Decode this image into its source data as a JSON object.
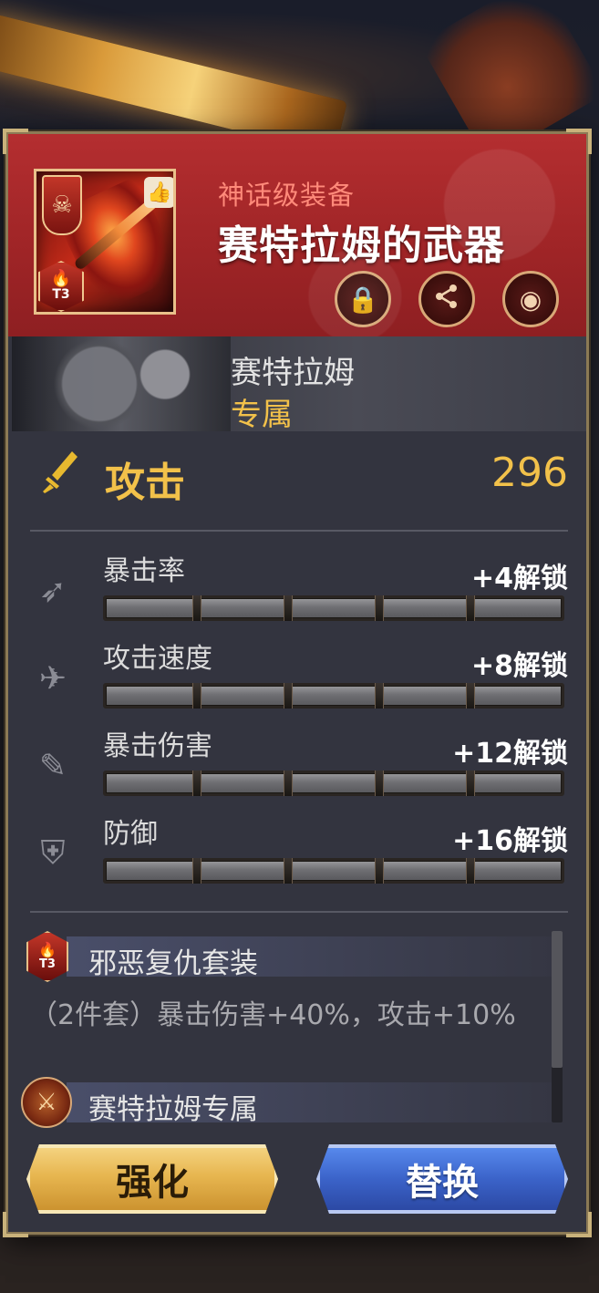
{
  "item": {
    "rarity": "神话级装备",
    "name": "赛特拉姆的武器",
    "tier": "T3",
    "header_buttons": [
      {
        "name": "lock-button",
        "icon": "lock-icon",
        "glyph": "🔒"
      },
      {
        "name": "share-button",
        "icon": "share-icon",
        "glyph": "⮚"
      },
      {
        "name": "sell-button",
        "icon": "coins-icon",
        "glyph": "◉"
      }
    ]
  },
  "hero": {
    "name": "赛特拉姆",
    "tag": "专属"
  },
  "main_stat": {
    "label": "攻击",
    "value": "296",
    "icon": "sword-icon"
  },
  "sub_stats": [
    {
      "label": "暴击率",
      "unlock": "+4解锁",
      "icon": "crit-rate-icon",
      "glyph": "➶"
    },
    {
      "label": "攻击速度",
      "unlock": "+8解锁",
      "icon": "attack-speed-icon",
      "glyph": "✈"
    },
    {
      "label": "暴击伤害",
      "unlock": "+12解锁",
      "icon": "crit-damage-icon",
      "glyph": "✎"
    },
    {
      "label": "防御",
      "unlock": "+16解锁",
      "icon": "shield-icon",
      "glyph": "⛨"
    }
  ],
  "set_bonus": {
    "title": "邪恶复仇套装",
    "description": "（2件套）暴击伤害+40%，攻击+10%",
    "exclusive_title": "赛特拉姆专属"
  },
  "buttons": {
    "enhance": "强化",
    "replace": "替换"
  },
  "colors": {
    "header_red": "#a8282a",
    "gold_accent": "#f2c14a",
    "panel_bg": "#33343f"
  }
}
